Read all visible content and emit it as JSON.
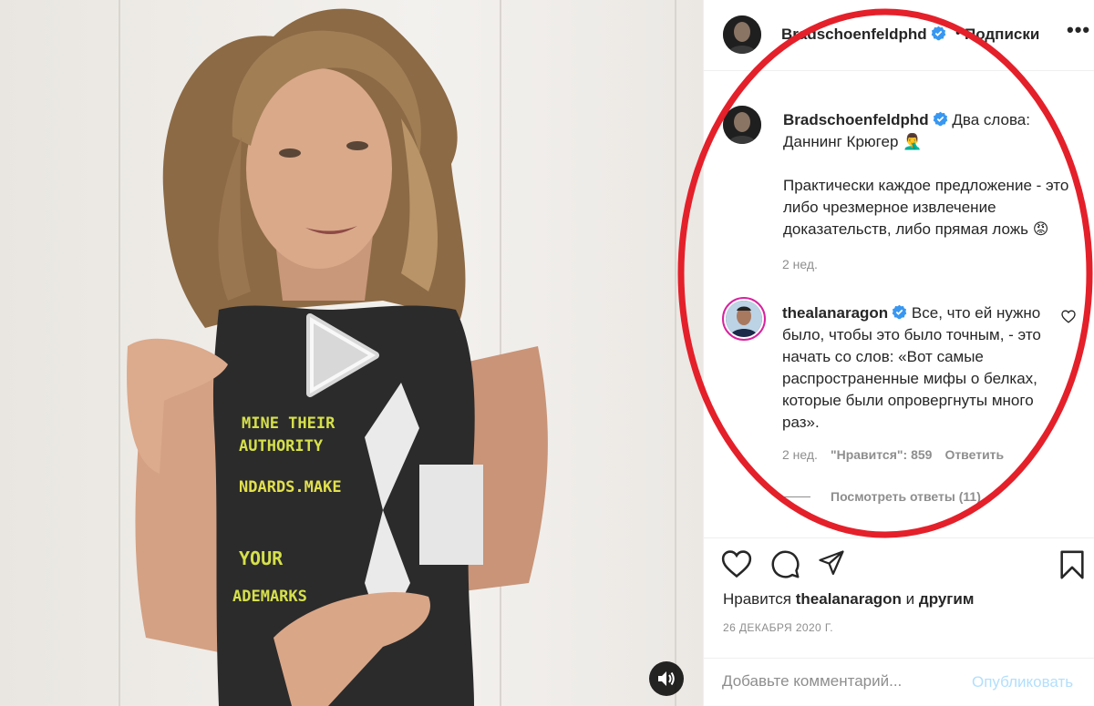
{
  "post": {
    "author": "Bradschoenfeldphd",
    "follow_label": "Подписки",
    "header_dot": "•",
    "more_label": "•••"
  },
  "caption": {
    "username": "Bradschoenfeldphd",
    "text_line1": " Два слова: Даннинг Крюгер 🤦‍♂️",
    "text_line2": "Практически каждое предложение - это либо чрезмерное извлечение доказательств, либо прямая ложь 😡",
    "time": "2 нед."
  },
  "comment": {
    "username": "thealanaragon",
    "text": " Все, что ей нужно было, чтобы это было точным, - это начать со слов: «Вот самые распространенные мифы о белках, которые были опровергнуты много раз».",
    "time": "2 нед.",
    "likes": "\"Нравится\": 859",
    "reply_label": "Ответить",
    "view_replies": "Посмотреть ответы (11)"
  },
  "likes": {
    "prefix": "Нравится ",
    "user": "thealanaragon",
    "middle": " и ",
    "suffix": "другим"
  },
  "date": "26 ДЕКАБРЯ 2020 Г.",
  "comment_box": {
    "placeholder": "Добавьте комментарий...",
    "publish_label": "Опубликовать"
  },
  "icons": {
    "verified": "verified-icon",
    "heart": "heart-icon",
    "comment": "comment-icon",
    "share": "share-icon",
    "bookmark": "bookmark-icon",
    "play": "play-icon",
    "sound": "speaker-icon"
  },
  "colors": {
    "verified": "#3897f0",
    "annotation_red": "#e4202a",
    "link_disabled": "#b2dffc",
    "muted_text": "#8e8e8e"
  }
}
